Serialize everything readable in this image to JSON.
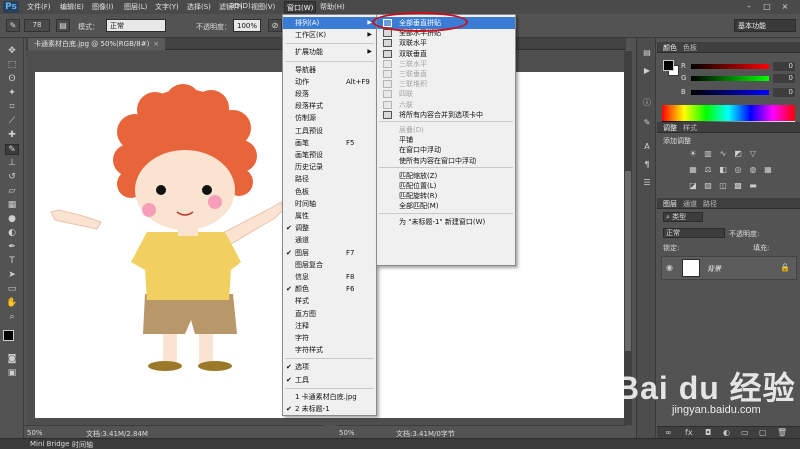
{
  "app": {
    "logo": "Ps",
    "menus": [
      "文件(F)",
      "编辑(E)",
      "图像(I)",
      "图层(L)",
      "文字(Y)",
      "选择(S)",
      "滤镜(T)",
      "3D(D)",
      "视图(V)",
      "窗口(W)",
      "帮助(H)"
    ],
    "active_menu": "窗口(W)"
  },
  "options_bar": {
    "brush_size": "78",
    "mode_label": "模式：",
    "mode_value": "正常",
    "opacity_label": "不透明度：",
    "opacity_value": "100%",
    "workspace": "基本功能"
  },
  "document": {
    "tab_title": "卡通素材白底.jpg @ 50%(RGB/8#)",
    "zoom_left": "50%",
    "doc_info_left": "文档:3.41M/2.84M",
    "zoom_right": "50%",
    "doc_info_right": "文档:3.41M/0字节"
  },
  "bottom_tabs": [
    "Mini Bridge",
    "时间轴"
  ],
  "window_menu": {
    "items": [
      {
        "label": "排列(A)",
        "submenu": true,
        "highlighted": true
      },
      {
        "label": "工作区(K)",
        "submenu": true
      },
      {
        "sep": true
      },
      {
        "label": "扩展功能",
        "submenu": true
      },
      {
        "sep": true
      },
      {
        "label": "导航器"
      },
      {
        "label": "动作",
        "shortcut": "Alt+F9"
      },
      {
        "label": "段落"
      },
      {
        "label": "段落样式"
      },
      {
        "label": "仿制源"
      },
      {
        "label": "工具预设"
      },
      {
        "label": "画笔",
        "shortcut": "F5"
      },
      {
        "label": "画笔预设"
      },
      {
        "label": "历史记录"
      },
      {
        "label": "路径"
      },
      {
        "label": "色板"
      },
      {
        "label": "时间轴"
      },
      {
        "label": "属性"
      },
      {
        "label": "调整",
        "checked": true
      },
      {
        "label": "通道"
      },
      {
        "label": "图层",
        "shortcut": "F7",
        "checked": true
      },
      {
        "label": "图层复合"
      },
      {
        "label": "信息",
        "shortcut": "F8"
      },
      {
        "label": "颜色",
        "shortcut": "F6",
        "checked": true
      },
      {
        "label": "样式"
      },
      {
        "label": "直方图"
      },
      {
        "label": "注释"
      },
      {
        "label": "字符"
      },
      {
        "label": "字符样式"
      },
      {
        "sep": true
      },
      {
        "label": "选项",
        "checked": true
      },
      {
        "label": "工具",
        "checked": true
      },
      {
        "sep": true
      },
      {
        "label": "1 卡通素材白底.jpg"
      },
      {
        "label": "2 未标题-1",
        "checked": true
      }
    ]
  },
  "arrange_submenu": {
    "items": [
      {
        "label": "全部垂直拼贴",
        "highlighted": true,
        "icon": true
      },
      {
        "label": "全部水平拼贴",
        "icon": true
      },
      {
        "label": "双联水平",
        "icon": true
      },
      {
        "label": "双联垂直",
        "icon": true
      },
      {
        "label": "三联水平",
        "icon": true,
        "disabled": true
      },
      {
        "label": "三联垂直",
        "icon": true,
        "disabled": true
      },
      {
        "label": "三联堆积",
        "icon": true,
        "disabled": true
      },
      {
        "label": "四联",
        "icon": true,
        "disabled": true
      },
      {
        "label": "六联",
        "icon": true,
        "disabled": true
      },
      {
        "label": "将所有内容合并到选项卡中",
        "icon": true
      },
      {
        "sep": true
      },
      {
        "label": "层叠(D)",
        "disabled": true
      },
      {
        "label": "平铺"
      },
      {
        "label": "在窗口中浮动"
      },
      {
        "label": "使所有内容在窗口中浮动"
      },
      {
        "sep": true
      },
      {
        "label": "匹配缩放(Z)"
      },
      {
        "label": "匹配位置(L)"
      },
      {
        "label": "匹配旋转(R)"
      },
      {
        "label": "全部匹配(M)"
      },
      {
        "sep": true
      },
      {
        "label": "为 \"未标题-1\" 新建窗口(W)"
      }
    ]
  },
  "color_panel": {
    "tabs": [
      "颜色",
      "色板"
    ],
    "channels": [
      {
        "name": "R",
        "value": "0"
      },
      {
        "name": "G",
        "value": "0"
      },
      {
        "name": "B",
        "value": "0"
      }
    ]
  },
  "adjust_panel": {
    "tabs": [
      "调整",
      "样式"
    ],
    "title": "添加调整"
  },
  "layers_panel": {
    "tabs": [
      "图层",
      "通道",
      "路径"
    ],
    "filter_label": "类型",
    "blend_mode": "正常",
    "opacity_label": "不透明度:",
    "lock_label": "锁定:",
    "fill_label": "填充:",
    "layer_name": "背景"
  },
  "watermark": {
    "main": "Bai du 经验",
    "sub": "jingyan.baidu.com"
  },
  "colors": {
    "highlight": "#3a7bd5",
    "annotation": "#c8101a",
    "hair": "#e8643a",
    "shirt": "#f2cf61",
    "shorts": "#b8976a"
  }
}
